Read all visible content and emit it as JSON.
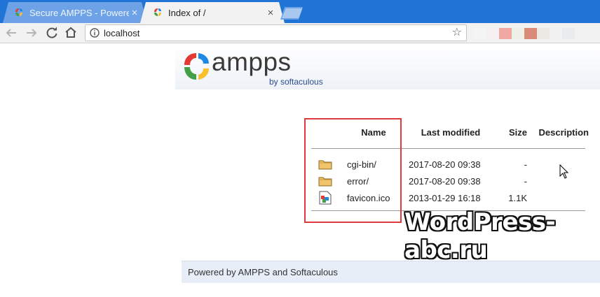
{
  "browser": {
    "tabs": [
      {
        "title": "Secure AMPPS - Powered",
        "active": false
      },
      {
        "title": "Index of /",
        "active": true
      }
    ],
    "tab_close_glyph": "×",
    "address": "localhost",
    "icons": {
      "back": "back-arrow-icon",
      "forward": "forward-arrow-icon",
      "reload": "reload-icon",
      "home": "home-icon",
      "info": "info-icon",
      "bookmark": "star-icon"
    }
  },
  "page": {
    "logo_name": "ampps",
    "logo_sub": "by softaculous",
    "table": {
      "headers": {
        "name": "Name",
        "modified": "Last modified",
        "size": "Size",
        "description": "Description"
      },
      "rows": [
        {
          "icon": "folder-icon",
          "name": "cgi-bin/",
          "modified": "2017-08-20 09:38",
          "size": "-",
          "description": ""
        },
        {
          "icon": "folder-icon",
          "name": "error/",
          "modified": "2017-08-20 09:38",
          "size": "-",
          "description": ""
        },
        {
          "icon": "image-file-icon",
          "name": "favicon.ico",
          "modified": "2013-01-29 16:18",
          "size": "1.1K",
          "description": ""
        }
      ]
    },
    "footer": "Powered by AMPPS and Softaculous"
  },
  "watermark": "WordPress-abc.ru",
  "colors": {
    "tabstrip": "#1f74d6",
    "highlight": "#e0393e",
    "footer_bg": "#e8eef7",
    "logo_sub": "#2b4c8c"
  }
}
